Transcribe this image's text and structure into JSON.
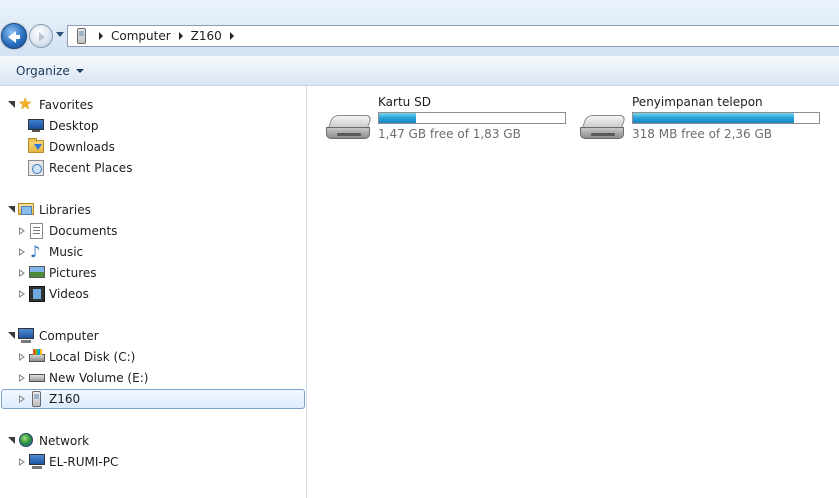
{
  "address_bar": {
    "breadcrumbs": [
      "Computer",
      "Z160"
    ]
  },
  "command_bar": {
    "organize_label": "Organize"
  },
  "nav": {
    "favorites": {
      "label": "Favorites",
      "items": [
        {
          "label": "Desktop",
          "icon": "desktop-icon"
        },
        {
          "label": "Downloads",
          "icon": "downloads-folder-icon"
        },
        {
          "label": "Recent Places",
          "icon": "recent-places-icon"
        }
      ]
    },
    "libraries": {
      "label": "Libraries",
      "items": [
        {
          "label": "Documents",
          "icon": "documents-icon"
        },
        {
          "label": "Music",
          "icon": "music-icon"
        },
        {
          "label": "Pictures",
          "icon": "pictures-icon"
        },
        {
          "label": "Videos",
          "icon": "videos-icon"
        }
      ]
    },
    "computer": {
      "label": "Computer",
      "items": [
        {
          "label": "Local Disk (C:)",
          "icon": "local-disk-icon"
        },
        {
          "label": "New Volume (E:)",
          "icon": "volume-icon"
        },
        {
          "label": "Z160",
          "icon": "phone-icon",
          "selected": true
        }
      ]
    },
    "network": {
      "label": "Network",
      "items": [
        {
          "label": "EL-RUMI-PC",
          "icon": "network-pc-icon"
        }
      ]
    }
  },
  "drives": [
    {
      "name": "Kartu SD",
      "free_text": "1,47 GB free of 1,83 GB",
      "used_fraction": 0.197
    },
    {
      "name": "Penyimpanan telepon",
      "free_text": "318 MB free of 2,36 GB",
      "used_fraction": 0.868
    }
  ],
  "colors": {
    "accent": "#26a0da",
    "selection_border": "#7da2ce",
    "command_text": "#1e395b"
  }
}
